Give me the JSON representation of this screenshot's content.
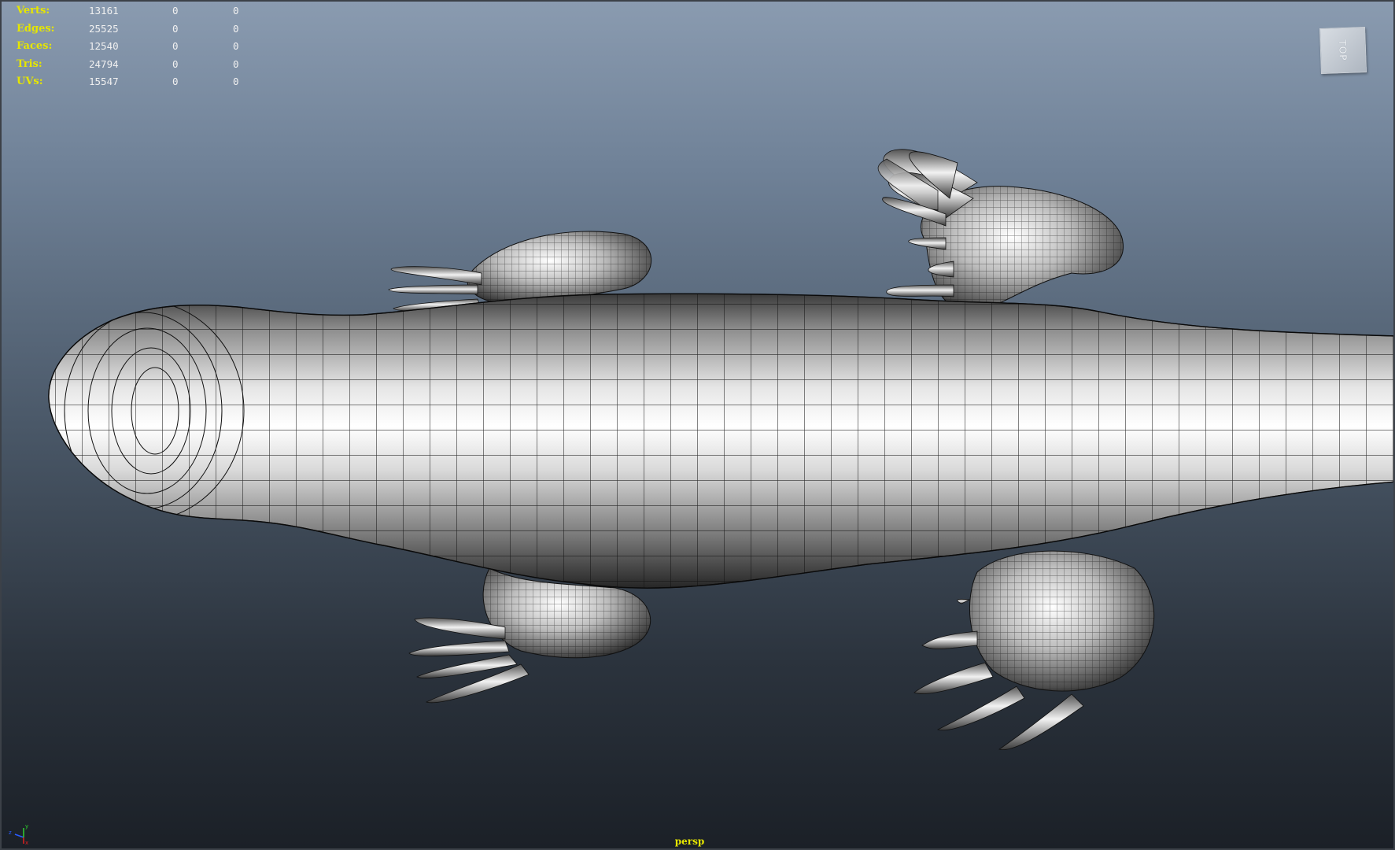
{
  "viewport": {
    "camera_label": "persp",
    "viewcube_label": "TOP"
  },
  "hud": {
    "rows": [
      {
        "label": "Verts:",
        "total": "13161",
        "selected": "0",
        "component": "0"
      },
      {
        "label": "Edges:",
        "total": "25525",
        "selected": "0",
        "component": "0"
      },
      {
        "label": "Faces:",
        "total": "12540",
        "selected": "0",
        "component": "0"
      },
      {
        "label": "Tris:",
        "total": "24794",
        "selected": "0",
        "component": "0"
      },
      {
        "label": "UVs:",
        "total": "15547",
        "selected": "0",
        "component": "0"
      }
    ]
  },
  "axis_gizmo": {
    "x_label": "x",
    "y_label": "y",
    "z_label": "z"
  },
  "colors": {
    "hud_text": "#e6e600",
    "wire": "#0c0c0c",
    "mesh_light": "#f4f4f4",
    "mesh_dark": "#2a2a2a"
  }
}
